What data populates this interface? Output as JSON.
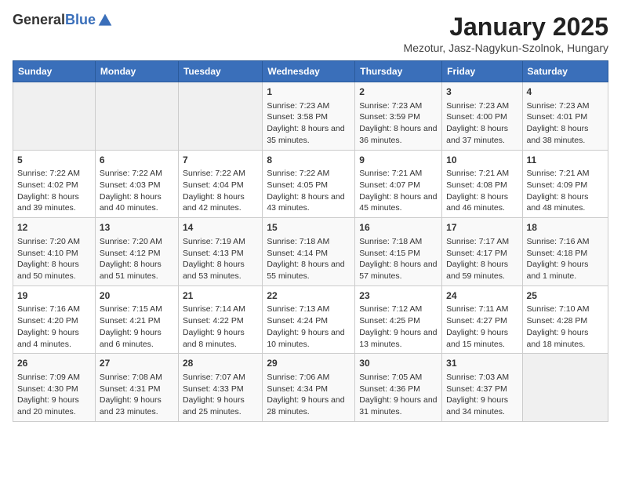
{
  "logo": {
    "general": "General",
    "blue": "Blue"
  },
  "title": "January 2025",
  "subtitle": "Mezotur, Jasz-Nagykun-Szolnok, Hungary",
  "days_of_week": [
    "Sunday",
    "Monday",
    "Tuesday",
    "Wednesday",
    "Thursday",
    "Friday",
    "Saturday"
  ],
  "weeks": [
    [
      {
        "day": "",
        "content": ""
      },
      {
        "day": "",
        "content": ""
      },
      {
        "day": "",
        "content": ""
      },
      {
        "day": "1",
        "content": "Sunrise: 7:23 AM\nSunset: 3:58 PM\nDaylight: 8 hours and 35 minutes."
      },
      {
        "day": "2",
        "content": "Sunrise: 7:23 AM\nSunset: 3:59 PM\nDaylight: 8 hours and 36 minutes."
      },
      {
        "day": "3",
        "content": "Sunrise: 7:23 AM\nSunset: 4:00 PM\nDaylight: 8 hours and 37 minutes."
      },
      {
        "day": "4",
        "content": "Sunrise: 7:23 AM\nSunset: 4:01 PM\nDaylight: 8 hours and 38 minutes."
      }
    ],
    [
      {
        "day": "5",
        "content": "Sunrise: 7:22 AM\nSunset: 4:02 PM\nDaylight: 8 hours and 39 minutes."
      },
      {
        "day": "6",
        "content": "Sunrise: 7:22 AM\nSunset: 4:03 PM\nDaylight: 8 hours and 40 minutes."
      },
      {
        "day": "7",
        "content": "Sunrise: 7:22 AM\nSunset: 4:04 PM\nDaylight: 8 hours and 42 minutes."
      },
      {
        "day": "8",
        "content": "Sunrise: 7:22 AM\nSunset: 4:05 PM\nDaylight: 8 hours and 43 minutes."
      },
      {
        "day": "9",
        "content": "Sunrise: 7:21 AM\nSunset: 4:07 PM\nDaylight: 8 hours and 45 minutes."
      },
      {
        "day": "10",
        "content": "Sunrise: 7:21 AM\nSunset: 4:08 PM\nDaylight: 8 hours and 46 minutes."
      },
      {
        "day": "11",
        "content": "Sunrise: 7:21 AM\nSunset: 4:09 PM\nDaylight: 8 hours and 48 minutes."
      }
    ],
    [
      {
        "day": "12",
        "content": "Sunrise: 7:20 AM\nSunset: 4:10 PM\nDaylight: 8 hours and 50 minutes."
      },
      {
        "day": "13",
        "content": "Sunrise: 7:20 AM\nSunset: 4:12 PM\nDaylight: 8 hours and 51 minutes."
      },
      {
        "day": "14",
        "content": "Sunrise: 7:19 AM\nSunset: 4:13 PM\nDaylight: 8 hours and 53 minutes."
      },
      {
        "day": "15",
        "content": "Sunrise: 7:18 AM\nSunset: 4:14 PM\nDaylight: 8 hours and 55 minutes."
      },
      {
        "day": "16",
        "content": "Sunrise: 7:18 AM\nSunset: 4:15 PM\nDaylight: 8 hours and 57 minutes."
      },
      {
        "day": "17",
        "content": "Sunrise: 7:17 AM\nSunset: 4:17 PM\nDaylight: 8 hours and 59 minutes."
      },
      {
        "day": "18",
        "content": "Sunrise: 7:16 AM\nSunset: 4:18 PM\nDaylight: 9 hours and 1 minute."
      }
    ],
    [
      {
        "day": "19",
        "content": "Sunrise: 7:16 AM\nSunset: 4:20 PM\nDaylight: 9 hours and 4 minutes."
      },
      {
        "day": "20",
        "content": "Sunrise: 7:15 AM\nSunset: 4:21 PM\nDaylight: 9 hours and 6 minutes."
      },
      {
        "day": "21",
        "content": "Sunrise: 7:14 AM\nSunset: 4:22 PM\nDaylight: 9 hours and 8 minutes."
      },
      {
        "day": "22",
        "content": "Sunrise: 7:13 AM\nSunset: 4:24 PM\nDaylight: 9 hours and 10 minutes."
      },
      {
        "day": "23",
        "content": "Sunrise: 7:12 AM\nSunset: 4:25 PM\nDaylight: 9 hours and 13 minutes."
      },
      {
        "day": "24",
        "content": "Sunrise: 7:11 AM\nSunset: 4:27 PM\nDaylight: 9 hours and 15 minutes."
      },
      {
        "day": "25",
        "content": "Sunrise: 7:10 AM\nSunset: 4:28 PM\nDaylight: 9 hours and 18 minutes."
      }
    ],
    [
      {
        "day": "26",
        "content": "Sunrise: 7:09 AM\nSunset: 4:30 PM\nDaylight: 9 hours and 20 minutes."
      },
      {
        "day": "27",
        "content": "Sunrise: 7:08 AM\nSunset: 4:31 PM\nDaylight: 9 hours and 23 minutes."
      },
      {
        "day": "28",
        "content": "Sunrise: 7:07 AM\nSunset: 4:33 PM\nDaylight: 9 hours and 25 minutes."
      },
      {
        "day": "29",
        "content": "Sunrise: 7:06 AM\nSunset: 4:34 PM\nDaylight: 9 hours and 28 minutes."
      },
      {
        "day": "30",
        "content": "Sunrise: 7:05 AM\nSunset: 4:36 PM\nDaylight: 9 hours and 31 minutes."
      },
      {
        "day": "31",
        "content": "Sunrise: 7:03 AM\nSunset: 4:37 PM\nDaylight: 9 hours and 34 minutes."
      },
      {
        "day": "",
        "content": ""
      }
    ]
  ]
}
